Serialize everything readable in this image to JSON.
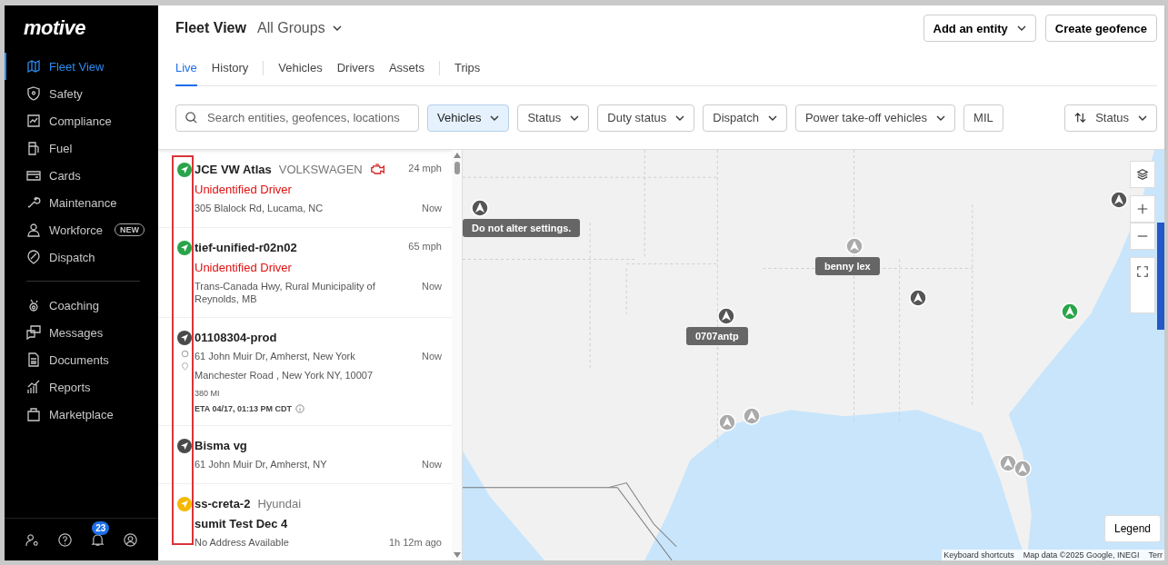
{
  "sidebar": {
    "logo": "motive",
    "items": [
      {
        "label": "Fleet View",
        "selected": true
      },
      {
        "label": "Safety",
        "selected": false
      },
      {
        "label": "Compliance",
        "selected": false
      },
      {
        "label": "Fuel",
        "selected": false
      },
      {
        "label": "Cards",
        "selected": false
      },
      {
        "label": "Maintenance",
        "selected": false
      },
      {
        "label": "Workforce",
        "selected": false,
        "badge": "NEW"
      },
      {
        "label": "Dispatch",
        "selected": false
      }
    ],
    "items_2": [
      {
        "label": "Coaching",
        "selected": false
      },
      {
        "label": "Messages",
        "selected": false
      },
      {
        "label": "Documents",
        "selected": false
      },
      {
        "label": "Reports",
        "selected": false
      },
      {
        "label": "Marketplace",
        "selected": false
      }
    ],
    "notification_count": "23"
  },
  "header": {
    "title": "Fleet View",
    "group": "All Groups",
    "buttons": [
      "Add an entity",
      "Create geofence"
    ]
  },
  "tabs": [
    [
      {
        "label": "Live",
        "selected": true
      },
      {
        "label": "History",
        "selected": false
      }
    ],
    [
      {
        "label": "Vehicles",
        "selected": false
      },
      {
        "label": "Drivers",
        "selected": false
      },
      {
        "label": "Assets",
        "selected": false
      }
    ],
    [
      {
        "label": "Trips",
        "selected": false
      }
    ]
  ],
  "search": {
    "placeholder": "Search entities, geofences, locations"
  },
  "filters": [
    {
      "label": "Vehicles",
      "kind": "dropdown",
      "selected": true
    },
    {
      "label": "Status",
      "kind": "dropdown",
      "selected": false
    },
    {
      "label": "Duty status",
      "kind": "dropdown",
      "selected": false
    },
    {
      "label": "Dispatch",
      "kind": "dropdown",
      "selected": false
    },
    {
      "label": "Power take-off vehicles",
      "kind": "dropdown",
      "selected": false
    },
    {
      "label": "MIL",
      "kind": "toggle",
      "selected": false
    }
  ],
  "sort": {
    "label": "Status"
  },
  "vehicles": [
    {
      "name": "JCE VW Atlas",
      "make": "VOLKSWAGEN",
      "engine_alert": true,
      "color": "#2aa44a",
      "speed": "24 mph",
      "driver": "Unidentified Driver",
      "driver_unidentified": true,
      "address": "305 Blalock Rd, Lucama, NC",
      "time": "Now"
    },
    {
      "name": "tief-unified-r02n02",
      "engine_alert": false,
      "color": "#2aa44a",
      "speed": "65 mph",
      "driver": "Unidentified Driver",
      "driver_unidentified": true,
      "address": "Trans-Canada Hwy, Rural Municipality of Reynolds, MB",
      "time": "Now"
    },
    {
      "name": "01108304-prod",
      "engine_alert": false,
      "color": "#4a4a4a",
      "address": "61 John Muir Dr, Amherst, New York",
      "time": "Now",
      "route": {
        "destination": "Manchester Road , New York NY, 10007",
        "distance": "380 MI",
        "eta": "ETA 04/17, 01:13 PM CDT"
      }
    },
    {
      "name": "Bisma vg",
      "engine_alert": false,
      "color": "#4a4a4a",
      "address": "61 John Muir Dr, Amherst, NY",
      "time": "Now"
    },
    {
      "name": "ss-creta-2",
      "make": "Hyundai",
      "engine_alert": false,
      "color": "#f5b800",
      "driver": "sumit Test Dec 4",
      "driver_unidentified": false,
      "address": "No Address Available",
      "time": "1h 12m ago"
    }
  ],
  "map": {
    "vehicle_labels": [
      "Do not alter settings.",
      "benny lex",
      "0707antp"
    ],
    "legend_button": "Legend",
    "attribution": [
      "Keyboard shortcuts",
      "Map data ©2025 Google, INEGI",
      "Terr"
    ]
  }
}
